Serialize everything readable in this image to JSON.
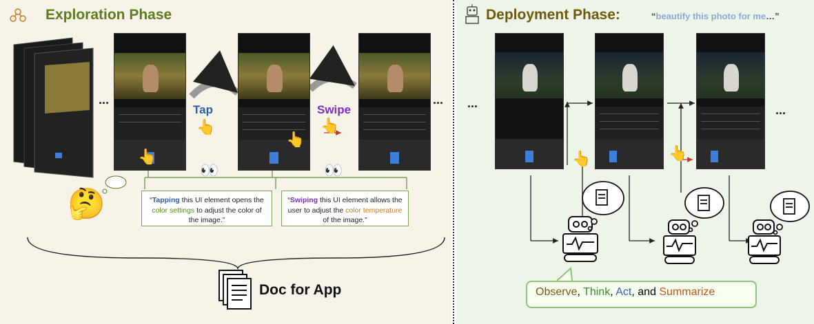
{
  "left_panel": {
    "title": "Exploration Phase",
    "title_icon": "network-icon",
    "tap_label": "Tap",
    "swipe_label": "Swipe",
    "ellipsis": "...",
    "caption_tap": {
      "q_open": "“",
      "bold": "Tapping",
      "t1": " this UI element opens the ",
      "colored": "color settings",
      "t2": " to adjust the color of the image.",
      "q_close": "”"
    },
    "caption_swipe": {
      "q_open": "“",
      "bold": "Swiping",
      "t1": " this UI element allows the user to adjust the ",
      "colored": "color temperature",
      "t2": " of the image.",
      "q_close": "”"
    },
    "doc_label": "Doc for App",
    "thinking_face": "🤔"
  },
  "right_panel": {
    "title": "Deployment Phase:",
    "title_icon": "robot-icon",
    "quote_open": "“",
    "quote_text": "beautify this photo for me",
    "quote_close": "…”",
    "ellipsis": "...",
    "summary": {
      "observe": "Observe",
      "sep1": ", ",
      "think": "Think",
      "sep2": ", ",
      "act": "Act",
      "sep3": ", and ",
      "summarize": "Summarize"
    }
  },
  "colors": {
    "left_bg": "#f7f3e8",
    "right_bg": "#edf4e8",
    "left_title": "#5a7d1e",
    "right_title": "#6e5a0e",
    "tap_color": "#2e5fa8",
    "swipe_color": "#7b2fbf",
    "caption_border": "#7aa35c",
    "summary_border": "#8bc27a"
  }
}
